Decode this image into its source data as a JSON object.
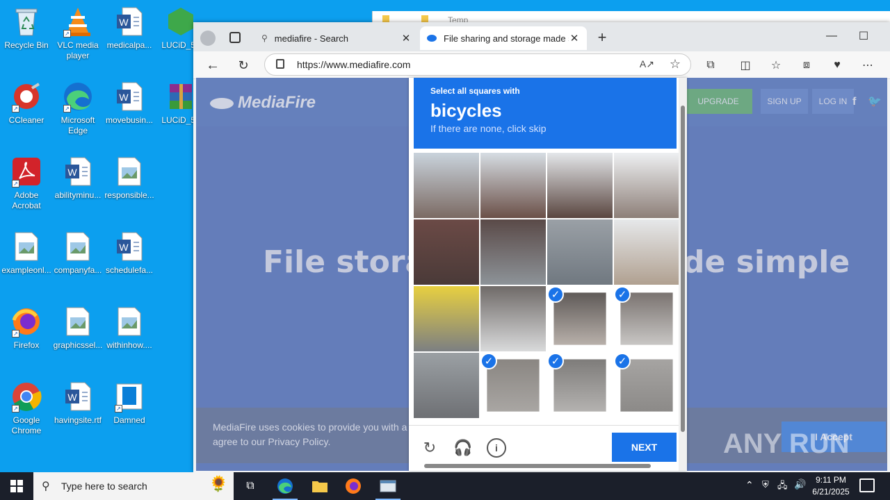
{
  "desktop": {
    "icons": [
      {
        "label": "Recycle Bin",
        "icon": "recycle-bin-icon"
      },
      {
        "label": "VLC media player",
        "icon": "vlc-icon"
      },
      {
        "label": "medicalpa...",
        "icon": "word-doc-icon"
      },
      {
        "label": "LUCiD_5e",
        "icon": "lucid-icon"
      },
      {
        "label": "CCleaner",
        "icon": "ccleaner-icon"
      },
      {
        "label": "Microsoft Edge",
        "icon": "edge-icon"
      },
      {
        "label": "movebusin...",
        "icon": "word-doc-icon"
      },
      {
        "label": "LUCiD_5e",
        "icon": "winrar-icon"
      },
      {
        "label": "Adobe Acrobat",
        "icon": "acrobat-icon"
      },
      {
        "label": "abilityminu...",
        "icon": "word-doc-icon"
      },
      {
        "label": "responsible...",
        "icon": "image-file-icon"
      },
      {
        "label": "exampleonl...",
        "icon": "image-file-icon"
      },
      {
        "label": "companyfa...",
        "icon": "image-file-icon"
      },
      {
        "label": "schedulefa...",
        "icon": "word-doc-icon"
      },
      {
        "label": "Firefox",
        "icon": "firefox-icon"
      },
      {
        "label": "graphicssel...",
        "icon": "image-file-icon"
      },
      {
        "label": "withinhow....",
        "icon": "image-file-icon"
      },
      {
        "label": "Google Chrome",
        "icon": "chrome-icon"
      },
      {
        "label": "havingsite.rtf",
        "icon": "word-doc-icon"
      },
      {
        "label": "Damned",
        "icon": "generic-file-icon"
      }
    ]
  },
  "background_window": {
    "title": "Temp"
  },
  "browser": {
    "tabs": [
      {
        "title": "mediafire - Search",
        "icon": "search-icon"
      },
      {
        "title": "File sharing and storage made sim",
        "icon": "mediafire-icon"
      }
    ],
    "address": "https://www.mediafire.com",
    "new_tab_label": "+"
  },
  "site": {
    "logo_text": "MediaFire",
    "upgrade_label": "UPGRADE",
    "signup_label": "SIGN UP",
    "login_label": "LOG IN",
    "hero_left": "File storag",
    "hero_right": "de simple",
    "cookie_msg": "MediaFire uses cookies to provide you with a p agree to our Privacy Policy.",
    "accept_label": "I Accept"
  },
  "captcha": {
    "instruction_small": "Select all squares with",
    "target": "bicycles",
    "hint": "If there are none, click skip",
    "selected_tiles": [
      10,
      11,
      13,
      14,
      15
    ],
    "next_label": "NEXT"
  },
  "taskbar": {
    "search_placeholder": "Type here to search",
    "time": "9:11 PM",
    "date": "6/21/2025"
  },
  "watermark": "ANY RUN"
}
